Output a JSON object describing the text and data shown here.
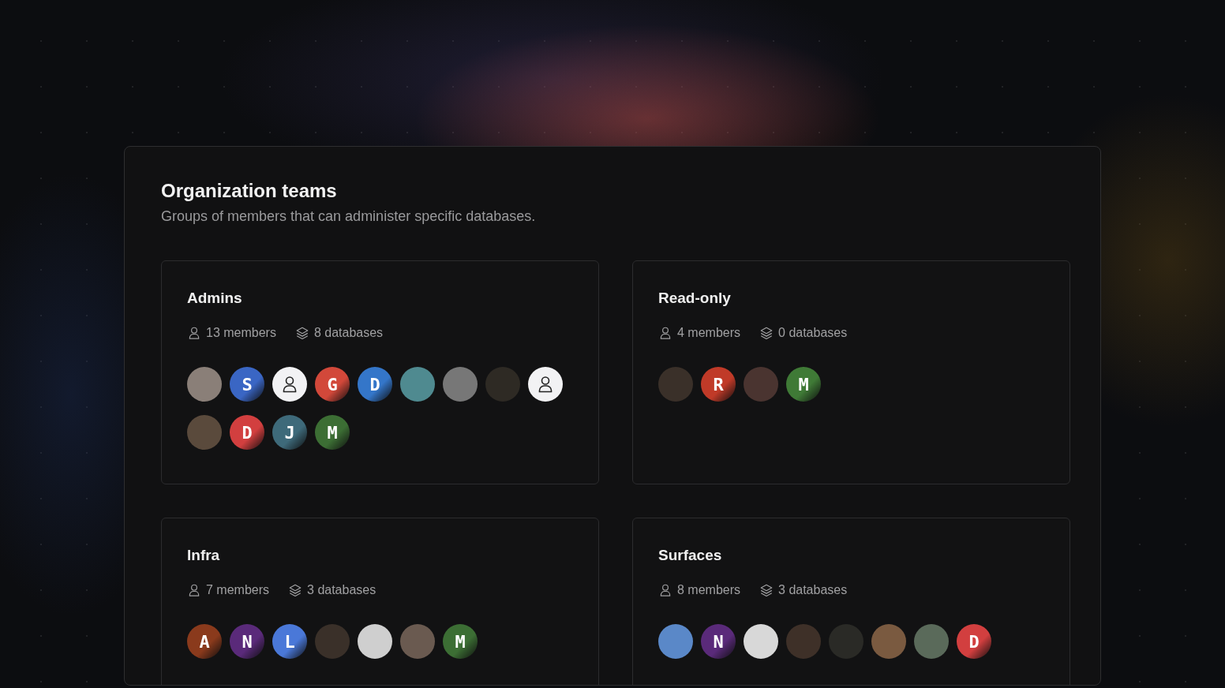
{
  "panel": {
    "title": "Organization teams",
    "subtitle": "Groups of members that can administer specific databases."
  },
  "teams": [
    {
      "name": "Admins",
      "members": "13 members",
      "databases": "8 databases",
      "avatars": [
        {
          "kind": "photo",
          "color": "#8a7f78"
        },
        {
          "kind": "letter",
          "letter": "S",
          "color": "#3a66c4"
        },
        {
          "kind": "placeholder"
        },
        {
          "kind": "letter",
          "letter": "G",
          "color": "#d2483a"
        },
        {
          "kind": "letter",
          "letter": "D",
          "color": "#3476c9"
        },
        {
          "kind": "photo",
          "color": "#4f8a90"
        },
        {
          "kind": "photo",
          "color": "#777777"
        },
        {
          "kind": "photo",
          "color": "#2e2a24"
        },
        {
          "kind": "placeholder"
        },
        {
          "kind": "photo",
          "color": "#5a4a3c"
        },
        {
          "kind": "letter",
          "letter": "D",
          "color": "#d23f3f"
        },
        {
          "kind": "letter",
          "letter": "J",
          "color": "#3e6a7a"
        },
        {
          "kind": "letter",
          "letter": "M",
          "color": "#3c6e34"
        }
      ]
    },
    {
      "name": "Read-only",
      "members": "4 members",
      "databases": "0 databases",
      "avatars": [
        {
          "kind": "photo",
          "color": "#3a3029"
        },
        {
          "kind": "letter",
          "letter": "R",
          "color": "#c03a28"
        },
        {
          "kind": "photo",
          "color": "#4a3430"
        },
        {
          "kind": "letter",
          "letter": "M",
          "color": "#3f7a36"
        }
      ]
    },
    {
      "name": "Infra",
      "members": "7 members",
      "databases": "3 databases",
      "avatars": [
        {
          "kind": "letter",
          "letter": "A",
          "color": "#8a3a1c"
        },
        {
          "kind": "letter",
          "letter": "N",
          "color": "#5a2a7a"
        },
        {
          "kind": "letter",
          "letter": "L",
          "color": "#4a78d8"
        },
        {
          "kind": "photo",
          "color": "#3a3029"
        },
        {
          "kind": "photo",
          "color": "#cfcfcf"
        },
        {
          "kind": "photo",
          "color": "#6a5a50"
        },
        {
          "kind": "letter",
          "letter": "M",
          "color": "#3c6e34"
        }
      ]
    },
    {
      "name": "Surfaces",
      "members": "8 members",
      "databases": "3 databases",
      "avatars": [
        {
          "kind": "photo",
          "color": "#5a88c8"
        },
        {
          "kind": "letter",
          "letter": "N",
          "color": "#5a2a7a"
        },
        {
          "kind": "photo",
          "color": "#d8d8d8"
        },
        {
          "kind": "photo",
          "color": "#3e3028"
        },
        {
          "kind": "photo",
          "color": "#2a2a26"
        },
        {
          "kind": "photo",
          "color": "#7a5a40"
        },
        {
          "kind": "photo",
          "color": "#5a6a5a"
        },
        {
          "kind": "letter",
          "letter": "D",
          "color": "#d23f3f"
        }
      ]
    }
  ]
}
